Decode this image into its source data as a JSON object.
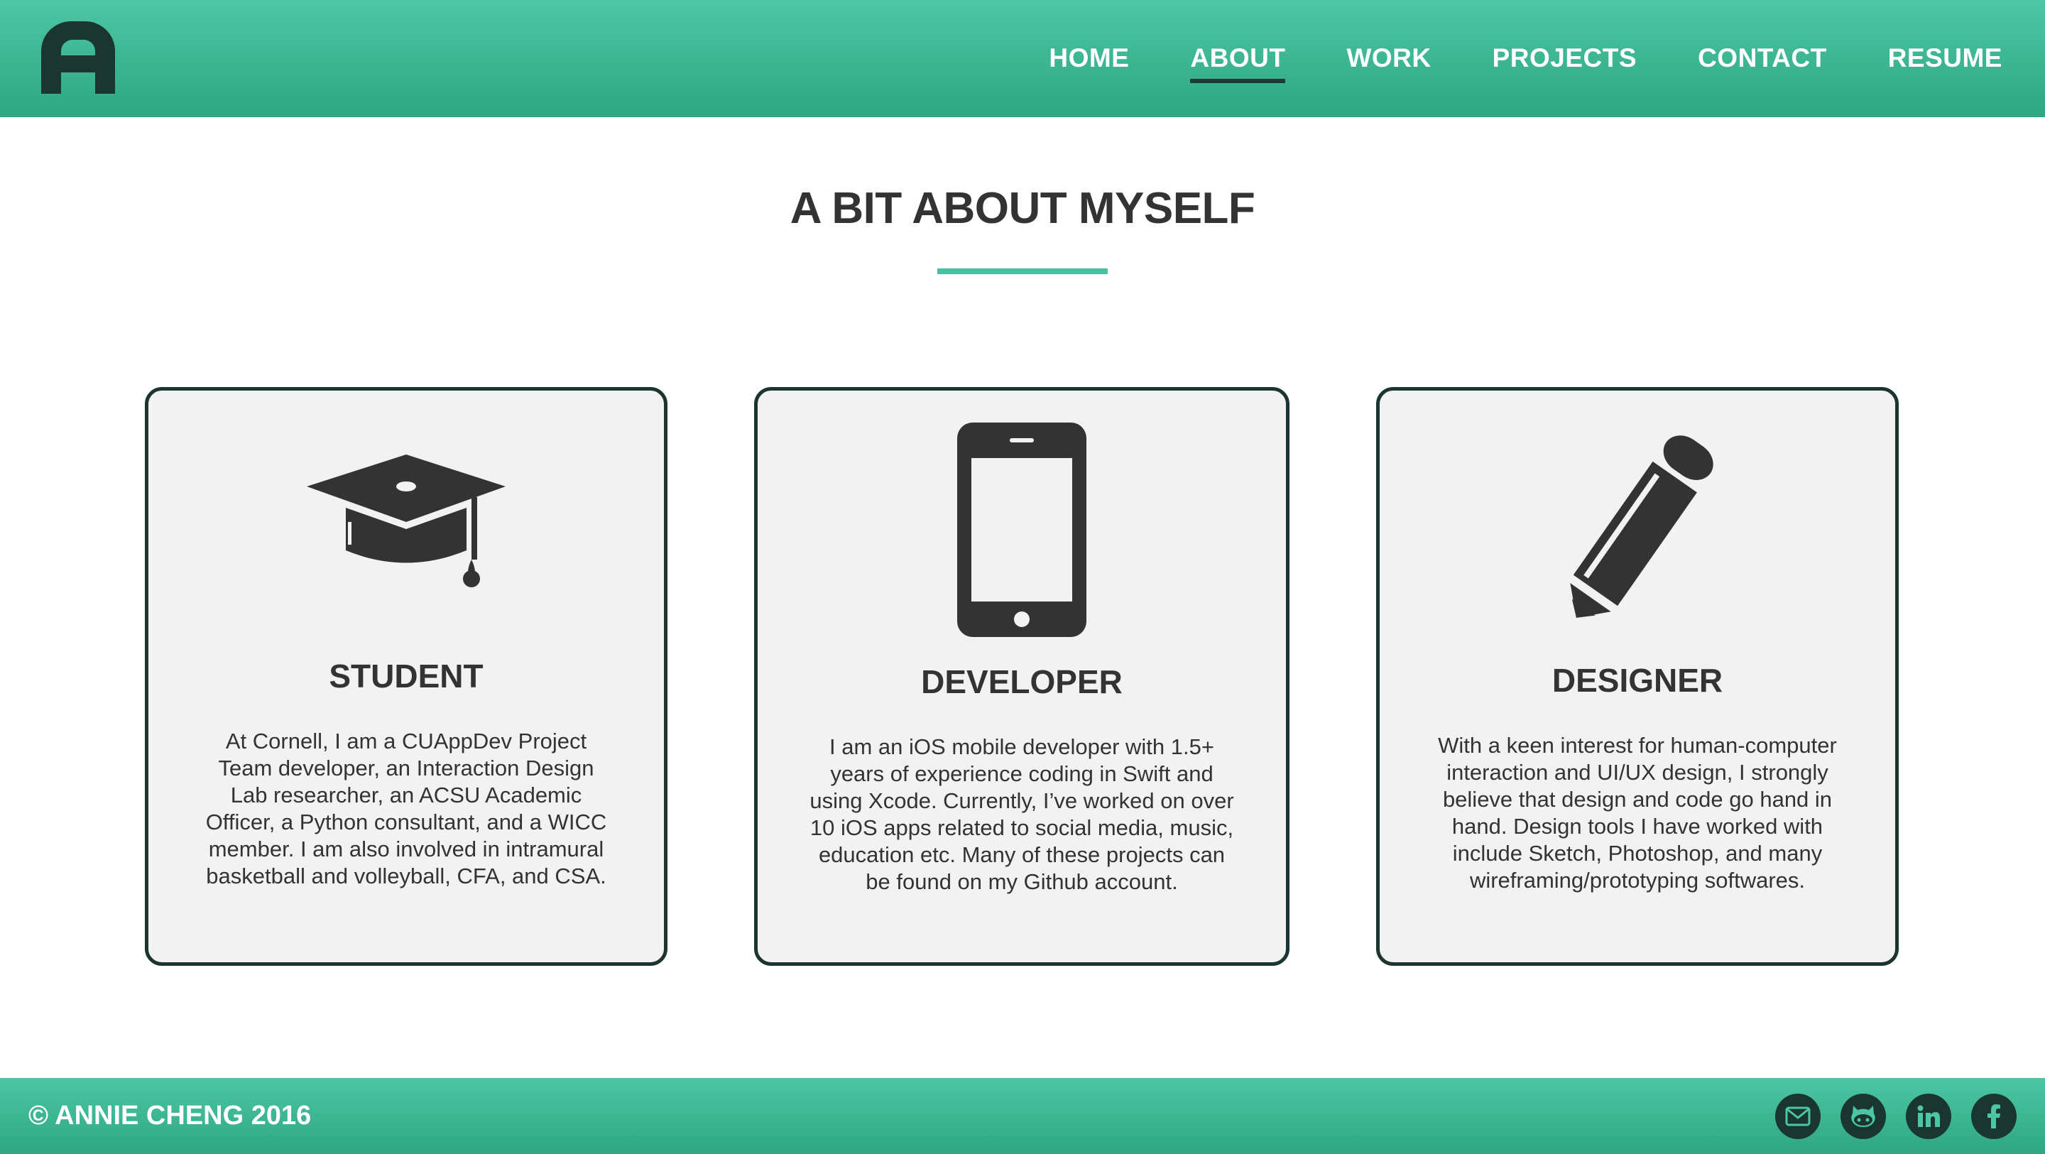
{
  "header": {
    "logo_icon": "letter-a-logo-icon",
    "nav": [
      {
        "label": "HOME",
        "active": false
      },
      {
        "label": "ABOUT",
        "active": true
      },
      {
        "label": "WORK",
        "active": false
      },
      {
        "label": "PROJECTS",
        "active": false
      },
      {
        "label": "CONTACT",
        "active": false
      },
      {
        "label": "RESUME",
        "active": false
      }
    ]
  },
  "main": {
    "title": "A BIT ABOUT MYSELF",
    "cards": [
      {
        "icon": "graduation-cap-icon",
        "heading": "STUDENT",
        "text": "At Cornell, I am a CUAppDev Project Team developer, an Interaction Design Lab researcher, an ACSU Academic Officer, a Python consultant, and a WICC member. I am also involved in intramural basketball and volleyball, CFA, and CSA."
      },
      {
        "icon": "mobile-phone-icon",
        "heading": "DEVELOPER",
        "text": "I am an iOS mobile developer with 1.5+ years of experience coding in Swift and using Xcode. Currently, I’ve worked on over 10 iOS apps related to social media, music, education etc. Many of these projects can be found on my Github account."
      },
      {
        "icon": "pencil-icon",
        "heading": "DESIGNER",
        "text": "With a keen interest for human-computer interaction and UI/UX design, I strongly believe that design and code go hand in hand. Design tools I have worked with include Sketch, Photoshop, and many wireframing/prototyping softwares."
      }
    ]
  },
  "footer": {
    "copyright": "© ANNIE CHENG 2016",
    "social": [
      "email-icon",
      "github-icon",
      "linkedin-icon",
      "facebook-icon"
    ]
  },
  "colors": {
    "accent": "#46c1a1",
    "header_gradient_top": "#4cc6a4",
    "header_gradient_bottom": "#2fa682",
    "dark": "#1b3530",
    "card_bg": "#f2f2f2",
    "text": "#333333"
  }
}
